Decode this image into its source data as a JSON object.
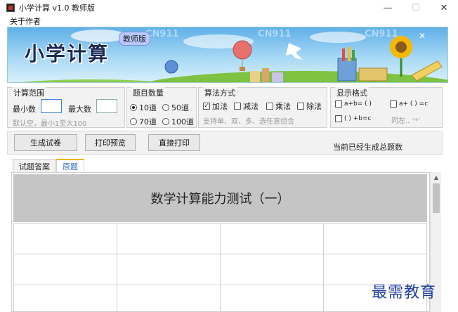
{
  "window": {
    "title": "小学计算 v1.0 教师版",
    "controls": {
      "minimize": "—",
      "maximize": "☐",
      "close": "✕"
    }
  },
  "menu": {
    "items": [
      "关于作者"
    ]
  },
  "banner": {
    "title": "小学计算",
    "badge": "教师版",
    "watermarks": [
      "CN911",
      "CN911",
      "CN911"
    ]
  },
  "range_group": {
    "title": "计算范围",
    "min_label": "最小数",
    "min_value": "",
    "max_label": "最大数",
    "max_value": "",
    "hint": "默认空，最小1至大100"
  },
  "count_group": {
    "title": "题目数量",
    "options": [
      {
        "label": "10道",
        "selected": true
      },
      {
        "label": "50道",
        "selected": false
      },
      {
        "label": "70道",
        "selected": false
      },
      {
        "label": "100道",
        "selected": false
      }
    ]
  },
  "ops_group": {
    "title": "算法方式",
    "options": [
      {
        "label": "加法",
        "checked": true
      },
      {
        "label": "减法",
        "checked": false
      },
      {
        "label": "乘法",
        "checked": false
      },
      {
        "label": "除法",
        "checked": false
      }
    ],
    "hint": "支持单、双、多、选任意组合"
  },
  "format_group": {
    "title": "显示格式",
    "options": [
      {
        "label": "a+b= ( )",
        "checked": false
      },
      {
        "label": "a+ ( ) =c",
        "checked": false
      },
      {
        "label": "( ) +b=c",
        "checked": false
      }
    ],
    "extra": "同左.. ‘*’"
  },
  "actions": {
    "generate": "生成试卷",
    "preview": "打印预览",
    "print": "直接打印",
    "status": "当前已经生成总题数"
  },
  "tabs": [
    {
      "label": "试题答案",
      "active": false
    },
    {
      "label": "原题",
      "active": true
    }
  ],
  "document": {
    "heading": "数学计算能力测试（一）",
    "rows": 3,
    "cols": 4
  },
  "scrollbar": {
    "up_arrow": "▲"
  },
  "logo": "最需教育"
}
